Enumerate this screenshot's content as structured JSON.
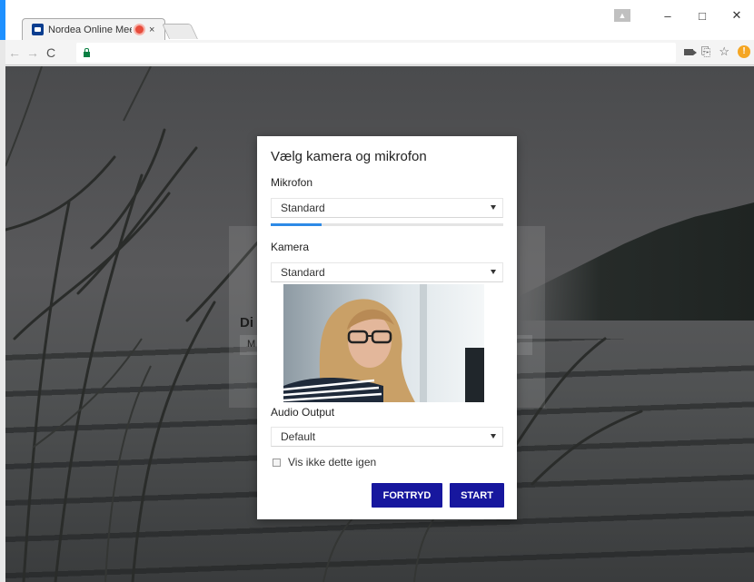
{
  "browser": {
    "tab_title": "Nordea Online Meeti",
    "tab_close": "×",
    "window_controls": {
      "minimize": "–",
      "maximize": "□",
      "close": "✕"
    },
    "nav": {
      "back": "←",
      "forward": "→",
      "reload": "C"
    },
    "toolbar_icons": [
      "camera-icon",
      "translate-icon",
      "star-icon",
      "extension-icon"
    ],
    "star_glyph": "☆",
    "translate_glyph": "⎘",
    "ext_glyph": "!"
  },
  "background": {
    "partial_title": "Di",
    "partial_field": "M"
  },
  "dialog": {
    "title": "Vælg kamera og mikrofon",
    "microphone": {
      "label": "Mikrofon",
      "selected": "Standard",
      "level": 0.22
    },
    "camera": {
      "label": "Kamera",
      "selected": "Standard"
    },
    "audio_output": {
      "label": "Audio Output",
      "selected": "Default"
    },
    "dont_show_again": {
      "label": "Vis ikke dette igen",
      "checked": false
    },
    "cancel_label": "FORTRYD",
    "start_label": "START"
  },
  "colors": {
    "primary_button": "#17179e",
    "meter_fill": "#2d8ae6",
    "recording_dot": "#e74c3c",
    "window_accent": "#1e90ff"
  }
}
